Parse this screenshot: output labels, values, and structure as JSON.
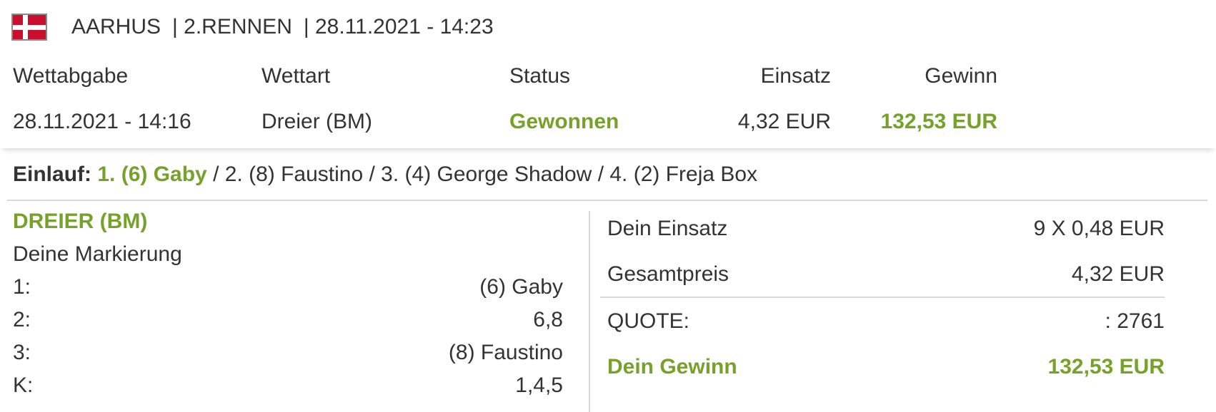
{
  "race": {
    "track": "AARHUS",
    "race_no": "| 2.RENNEN",
    "datetime": "| 28.11.2021 - 14:23",
    "flag_icon": "denmark-flag-icon"
  },
  "bet_summary": {
    "headers": {
      "wettabgabe": "Wettabgabe",
      "wettart": "Wettart",
      "status": "Status",
      "einsatz": "Einsatz",
      "gewinn": "Gewinn"
    },
    "values": {
      "wettabgabe": "28.11.2021 - 14:16",
      "wettart": "Dreier (BM)",
      "status": "Gewonnen",
      "einsatz": "4,32 EUR",
      "gewinn": "132,53 EUR"
    }
  },
  "einlauf": {
    "label": "Einlauf:",
    "first": "1. (6) Gaby",
    "second": "/ 2. (8) Faustino",
    "third": "/ 3. (4) George Shadow",
    "fourth": "/ 4. (2) Freja Box"
  },
  "bet_details": {
    "title": "DREIER (BM)",
    "markierung_label": "Deine Markierung",
    "rows": [
      {
        "key": "1:",
        "value": "(6) Gaby"
      },
      {
        "key": "2:",
        "value": "6,8"
      },
      {
        "key": "3:",
        "value": "(8) Faustino"
      },
      {
        "key": "K:",
        "value": "1,4,5"
      }
    ]
  },
  "totals": {
    "einsatz_label": "Dein Einsatz",
    "einsatz_value": "9 X 0,48 EUR",
    "gesamtpreis_label": "Gesamtpreis",
    "gesamtpreis_value": "4,32 EUR",
    "quote_label": "QUOTE:",
    "quote_value": ": 2761",
    "gewinn_label": "Dein Gewinn",
    "gewinn_value": "132,53 EUR"
  },
  "colors": {
    "accent_green": "#76a12b",
    "text": "#333333",
    "divider": "#d9d9d9"
  }
}
